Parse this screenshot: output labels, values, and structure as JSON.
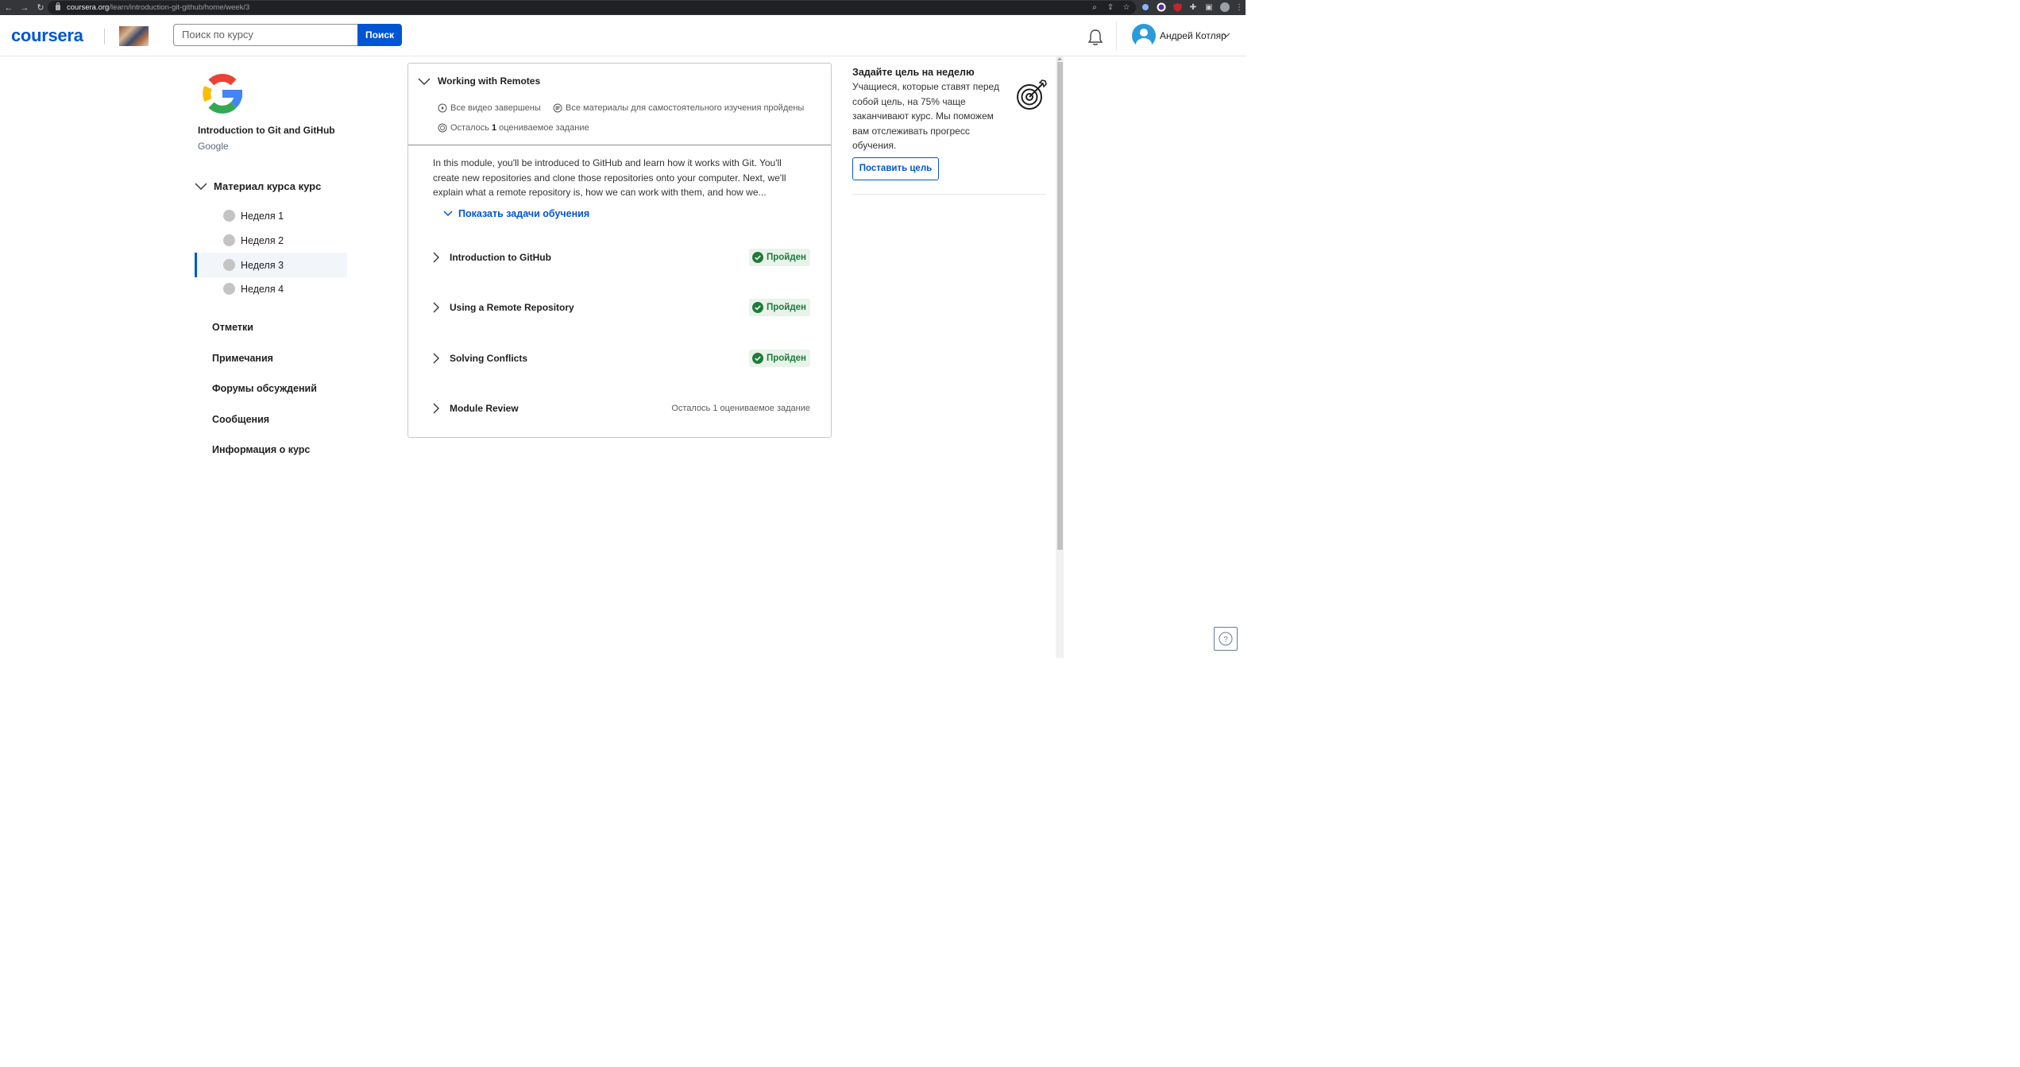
{
  "browser": {
    "url_host": "coursera.org",
    "url_path": "/learn/introduction-git-github/home/week/3"
  },
  "header": {
    "logo": "coursera",
    "search_placeholder": "Поиск по курсу",
    "search_button": "Поиск",
    "user_name": "Андрей Котляр"
  },
  "sidebar": {
    "course_title": "Introduction to Git and GitHub",
    "course_org": "Google",
    "material_label": "Материал курса курс",
    "weeks": [
      {
        "label": "Неделя 1"
      },
      {
        "label": "Неделя 2"
      },
      {
        "label": "Неделя 3",
        "active": true
      },
      {
        "label": "Неделя 4"
      }
    ],
    "links": [
      "Отметки",
      "Примечания",
      "Форумы обсуждений",
      "Сообщения",
      "Информация о курс"
    ]
  },
  "module": {
    "title": "Working with Remotes",
    "meta_videos": "Все видео завершены",
    "meta_readings": "Все материалы для самостоятельного изучения пройдены",
    "meta_remaining_prefix": "Осталось",
    "meta_remaining_count": "1",
    "meta_remaining_suffix": "оцениваемое задание",
    "description": "In this module, you'll be introduced to GitHub and learn how it works with Git. You'll create new repositories and clone those repositories onto your computer. Next, we'll explain what a remote repository is, how we can work with them, and how we...",
    "show_objectives": "Показать задачи обучения",
    "lessons": [
      {
        "name": "Introduction to GitHub",
        "status": "Пройден"
      },
      {
        "name": "Using a Remote Repository",
        "status": "Пройден"
      },
      {
        "name": "Solving Conflicts",
        "status": "Пройден"
      },
      {
        "name": "Module Review",
        "status": "Осталось 1 оцениваемое задание"
      }
    ]
  },
  "goal": {
    "title": "Задайте цель на неделю",
    "text": "Учащиеся, которые ставят перед собой цель, на 75% чаще заканчивают курс. Мы поможем вам отслеживать прогресс обучения.",
    "button": "Поставить цель"
  },
  "colors": {
    "brand": "#0056d2",
    "success": "#1e7b3a",
    "success_bg": "#e8f3ea"
  }
}
